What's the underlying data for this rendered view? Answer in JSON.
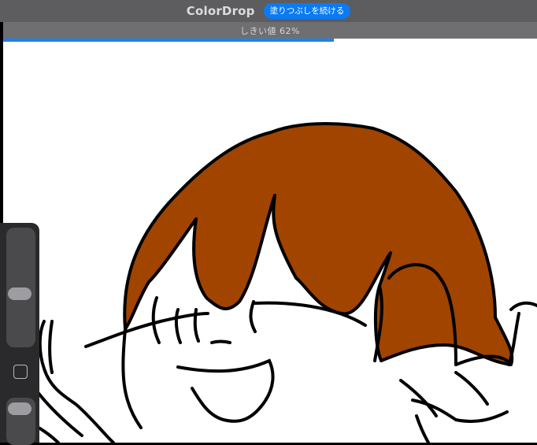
{
  "app": {
    "title": "ColorDrop",
    "continue_button_label": "塗りつぶしを続ける"
  },
  "threshold": {
    "label": "しきい値 62%",
    "value_percent": 62
  },
  "progress": {
    "fraction": 0.62
  },
  "colors": {
    "accent": "#0a7bf5",
    "fill_color": "#a04400",
    "line_color": "#000000",
    "canvas_bg": "#ffffff"
  },
  "tools": {
    "slider_top_icon": "vertical-slider",
    "square_icon": "square-icon",
    "slider_bottom_icon": "vertical-slider"
  }
}
